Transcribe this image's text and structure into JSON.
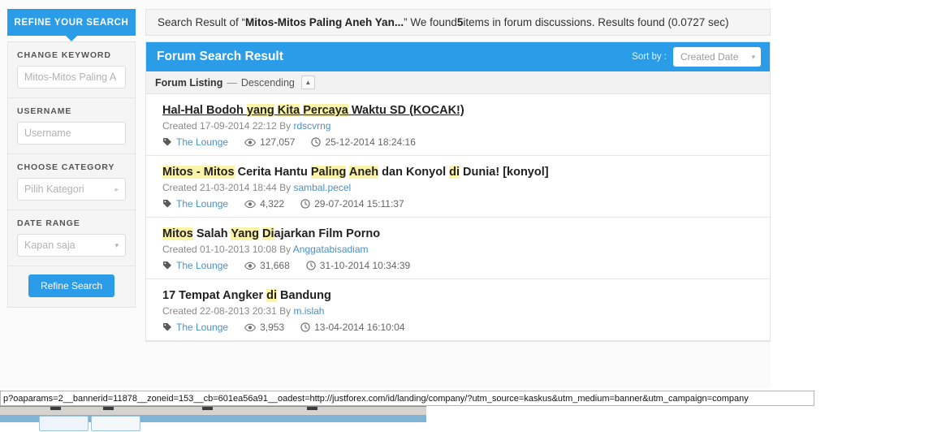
{
  "refine_tab": {
    "label": "REFINE YOUR SEARCH"
  },
  "result_banner": {
    "prefix": "Search Result of “",
    "query": "Mitos-Mitos Paling Aneh Yan...",
    "middle": "” We found ",
    "count": "5",
    "suffix": " items in forum discussions. Results found (0.0727 sec)"
  },
  "sidebar": {
    "groups": [
      {
        "label": "CHANGE KEYWORD",
        "name": "keyword",
        "value": "",
        "placeholder": "Mitos-Mitos Paling A",
        "kind": "text"
      },
      {
        "label": "USERNAME",
        "name": "username",
        "value": "",
        "placeholder": "Username",
        "kind": "text"
      },
      {
        "label": "CHOOSE CATEGORY",
        "name": "category",
        "value": "Pilih Kategori",
        "kind": "select-right",
        "caret": "▸"
      },
      {
        "label": "DATE RANGE",
        "name": "daterange",
        "value": "Kapan saja",
        "kind": "select-down",
        "caret": "▾"
      }
    ],
    "submit_label": "Refine Search"
  },
  "panel": {
    "title": "Forum Search Result",
    "sort_by_label": "Sort by :",
    "sort_by_value": "Created Date",
    "sort_caret": "▾",
    "listing_label": "Forum Listing",
    "listing_dash": "—",
    "listing_order": "Descending",
    "sort_toggle_icon": "▲"
  },
  "results": [
    {
      "title_parts": [
        {
          "text": "Hal-Hal Bodoh ",
          "hl": false
        },
        {
          "text": "yang",
          "hl": true
        },
        {
          "text": " ",
          "hl": false
        },
        {
          "text": "Kita",
          "hl": true
        },
        {
          "text": " ",
          "hl": false
        },
        {
          "text": "Percaya",
          "hl": true
        },
        {
          "text": " Waktu SD (KOCAK!)",
          "hl": false
        }
      ],
      "underlined": true,
      "created": "Created 17-09-2014 22:12 By ",
      "author": "rdscvrng",
      "forum": "The Lounge",
      "views": "127,057",
      "last_post": "25-12-2014 18:24:16"
    },
    {
      "title_parts": [
        {
          "text": "Mitos - Mitos",
          "hl": true
        },
        {
          "text": " Cerita Hantu ",
          "hl": false
        },
        {
          "text": "Paling",
          "hl": true
        },
        {
          "text": " ",
          "hl": false
        },
        {
          "text": "Aneh",
          "hl": true
        },
        {
          "text": " dan Konyol ",
          "hl": false
        },
        {
          "text": "di",
          "hl": true
        },
        {
          "text": " Dunia! [konyol]",
          "hl": false
        }
      ],
      "underlined": false,
      "created": "Created 21-03-2014 18:44 By ",
      "author": "sambal.pecel",
      "forum": "The Lounge",
      "views": "4,322",
      "last_post": "29-07-2014 15:11:37"
    },
    {
      "title_parts": [
        {
          "text": "Mitos",
          "hl": true
        },
        {
          "text": " Salah ",
          "hl": false
        },
        {
          "text": "Yang",
          "hl": true
        },
        {
          "text": " ",
          "hl": false
        },
        {
          "text": "Di",
          "hl": true
        },
        {
          "text": "ajarkan Film Porno",
          "hl": false
        }
      ],
      "underlined": false,
      "created": "Created 01-10-2013 10:08 By ",
      "author": "Anggatabisadiam",
      "forum": "The Lounge",
      "views": "31,668",
      "last_post": "31-10-2014 10:34:39"
    },
    {
      "title_parts": [
        {
          "text": "17 Tempat Angker ",
          "hl": false
        },
        {
          "text": "di",
          "hl": true
        },
        {
          "text": " Bandung",
          "hl": false
        }
      ],
      "underlined": false,
      "created": "Created 22-08-2013 20:31 By ",
      "author": "m.islah",
      "forum": "The Lounge",
      "views": "3,953",
      "last_post": "13-04-2014 16:10:04"
    }
  ],
  "status_bar": {
    "url": "p?oaparams=2__bannerid=11878__zoneid=153__cb=601ea56a91__oadest=http://justforex.com/id/landing/company/?utm_source=kaskus&utm_medium=banner&utm_campaign=company"
  },
  "colors": {
    "accent_blue": "#2b9ce8",
    "highlight_yellow": "#fbf3a8",
    "link_blue": "#4a90c4"
  }
}
